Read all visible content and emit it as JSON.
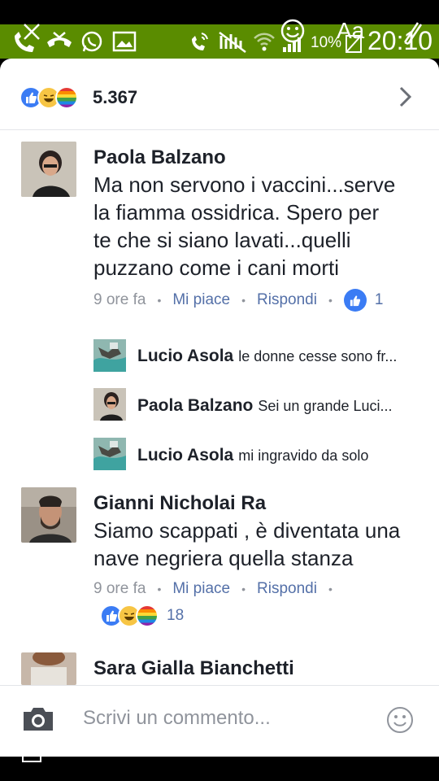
{
  "status_bar": {
    "battery": "10%",
    "time": "20:10",
    "font_overlay": "Aa",
    "icons": [
      "missed-call-icon",
      "call-end-icon",
      "whatsapp-icon",
      "image-icon",
      "vibrate-icon",
      "no-signal-icon",
      "wifi-icon",
      "signal-icon",
      "battery-icon"
    ]
  },
  "reactions_header": {
    "count": "5.367",
    "icons": [
      "like-icon",
      "haha-icon",
      "pride-icon"
    ]
  },
  "comments": [
    {
      "author": "Paola Balzano",
      "lines": [
        "Ma non servono i vaccini...serve",
        "la fiamma ossidrica. Spero per",
        "te che si siano lavati...quelli",
        "puzzano come i cani morti"
      ],
      "time": "9 ore fa",
      "like_label": "Mi piace",
      "reply_label": "Rispondi",
      "like_count": "1"
    },
    {
      "author": "Gianni Nicholai Ra",
      "lines": [
        "Siamo scappati , è diventata una",
        "nave negriera quella stanza"
      ],
      "time": "9 ore fa",
      "like_label": "Mi piace",
      "reply_label": "Rispondi",
      "reaction_count": "18"
    },
    {
      "author": "Sara Gialla Bianchetti"
    }
  ],
  "replies": [
    {
      "author": "Lucio Asola",
      "text": "le donne cesse sono fr..."
    },
    {
      "author": "Paola Balzano",
      "text": "Sei un grande Luci..."
    },
    {
      "author": "Lucio Asola",
      "text": "mi ingravido da solo"
    }
  ],
  "composer": {
    "placeholder": "Scrivi un commento..."
  },
  "colors": {
    "status_green": "#5a8c00",
    "link_blue": "#5470a8",
    "like_blue": "#3b7cf4",
    "meta_gray": "#90949c"
  }
}
